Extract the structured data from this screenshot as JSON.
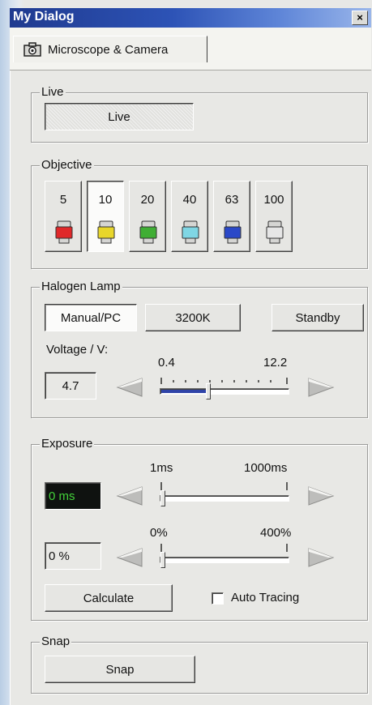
{
  "window": {
    "title": "My Dialog",
    "close_glyph": "×"
  },
  "tabs": [
    {
      "label": "Microscope & Camera",
      "icon": "camera-icon",
      "active": true
    }
  ],
  "live": {
    "group_label": "Live",
    "button_label": "Live",
    "pressed": true
  },
  "objective": {
    "group_label": "Objective",
    "selected": "10",
    "items": [
      {
        "label": "5",
        "band_color": "#e0282a"
      },
      {
        "label": "10",
        "band_color": "#e8d62b"
      },
      {
        "label": "20",
        "band_color": "#3fae34"
      },
      {
        "label": "40",
        "band_color": "#7fd6e4"
      },
      {
        "label": "63",
        "band_color": "#2a48c8"
      },
      {
        "label": "100",
        "band_color": "#e6e6e6"
      }
    ]
  },
  "halogen": {
    "group_label": "Halogen Lamp",
    "mode_buttons": [
      {
        "label": "Manual/PC",
        "active": true
      },
      {
        "label": "3200K",
        "active": false
      },
      {
        "label": "Standby",
        "active": false
      }
    ],
    "voltage_label": "Voltage / V:",
    "voltage_value": "4.7",
    "slider_min_label": "0.4",
    "slider_max_label": "12.2",
    "slider_fraction": 0.37
  },
  "exposure": {
    "group_label": "Exposure",
    "time_value": "0 ms",
    "time_min_label": "1ms",
    "time_max_label": "1000ms",
    "time_fraction": 0.0,
    "gain_value": "0 %",
    "gain_min_label": "0%",
    "gain_max_label": "400%",
    "gain_fraction": 0.0,
    "calculate_label": "Calculate",
    "auto_tracing_label": "Auto Tracing",
    "auto_tracing_checked": false
  },
  "snap": {
    "group_label": "Snap",
    "button_label": "Snap"
  },
  "colors": {
    "title_start": "#1f3a8f",
    "title_end": "#9ab6ea",
    "slider_fill": "#2f44a8",
    "readout_green": "#43d13a"
  }
}
